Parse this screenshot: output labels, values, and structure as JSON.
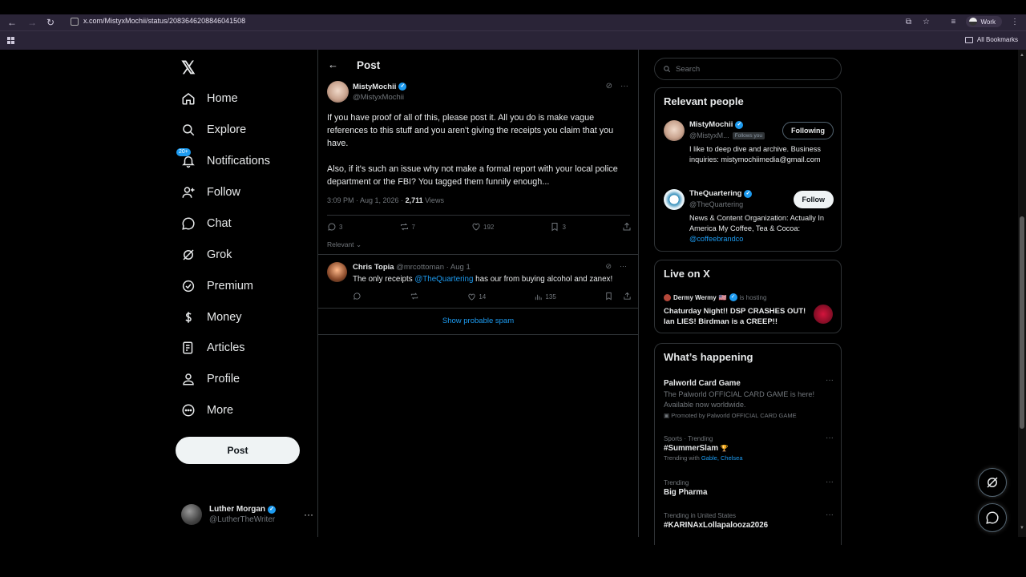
{
  "browser": {
    "url": "x.com/MistyxMochii/status/2083646208846041508",
    "profile_label": "Work",
    "bookmarks_label": "All Bookmarks"
  },
  "nav": {
    "items": [
      {
        "label": "Home",
        "icon": "home-icon"
      },
      {
        "label": "Explore",
        "icon": "search-icon"
      },
      {
        "label": "Notifications",
        "icon": "bell-icon",
        "badge": "20+"
      },
      {
        "label": "Follow",
        "icon": "person-add-icon"
      },
      {
        "label": "Chat",
        "icon": "chat-icon"
      },
      {
        "label": "Grok",
        "icon": "grok-icon"
      },
      {
        "label": "Premium",
        "icon": "verified-icon"
      },
      {
        "label": "Money",
        "icon": "money-icon"
      },
      {
        "label": "Articles",
        "icon": "article-icon"
      },
      {
        "label": "Profile",
        "icon": "profile-icon"
      },
      {
        "label": "More",
        "icon": "more-circle-icon"
      }
    ],
    "post_button": "Post",
    "account": {
      "name": "Luther Morgan",
      "handle": "@LutherTheWriter"
    }
  },
  "main": {
    "title": "Post",
    "tweet": {
      "name": "MistyMochii",
      "handle": "@MistyxMochii",
      "para1": "If you have proof of all of this, please post it. All you do is make vague references to this stuff and you aren't giving the receipts you claim that you have.",
      "para2": "Also, if it's such an issue why not make a formal report with your local police department or the FBI? You tagged them funnily enough...",
      "time": "3:09 PM · Aug 1, 2026 · ",
      "views_count": "2,711",
      "views_label": " Views",
      "replies": "3",
      "reposts": "7",
      "likes": "192",
      "bookmarks": "3"
    },
    "sort_label": "Relevant",
    "reply": {
      "name": "Chris Topia",
      "handle_time": " @mrcottoman · Aug 1",
      "text_before": "The only receipts ",
      "mention": "@TheQuartering",
      "text_after": "  has our from buying alcohol and zanex!",
      "likes": "14",
      "views": "135"
    },
    "spam_link": "Show probable spam"
  },
  "right": {
    "search_placeholder": "Search",
    "relevant_title": "Relevant people",
    "people": [
      {
        "name": "MistyMochii",
        "handle": "@MistyxM...",
        "follows_you": "Follows you",
        "bio": "I like to deep dive and archive. Business inquiries: mistymochiimedia@gmail.com",
        "button": "Following"
      },
      {
        "name": "TheQuartering",
        "handle": "@TheQuartering",
        "bio_text": "News & Content Organization: Actually In America My Coffee, Tea & Cocoa: ",
        "bio_link": "@coffeebrandco",
        "button": "Follow"
      }
    ],
    "live": {
      "title": "Live on X",
      "host_name": "Dermy Wermy",
      "host_flag": "🇺🇸",
      "host_suffix": "is hosting",
      "space_title": "Chaturday Night!! DSP CRASHES OUT! Ian LIES! Birdman is a CREEP!!"
    },
    "happening": {
      "title": "What’s happening",
      "trends": [
        {
          "category": "",
          "title": "Palworld Card Game",
          "desc": "The Palworld OFFICIAL CARD GAME is here! Available now worldwide.",
          "promo": "Promoted by Palworld OFFICIAL CARD GAME"
        },
        {
          "category": "Sports · Trending",
          "title": "#SummerSlam",
          "trending_with_label": "Trending with ",
          "trending_with": "Gable, Chelsea"
        },
        {
          "category": "Trending",
          "title": "Big Pharma"
        },
        {
          "category": "Trending in United States",
          "title": "#KARINAxLollapalooza2026"
        }
      ]
    }
  }
}
